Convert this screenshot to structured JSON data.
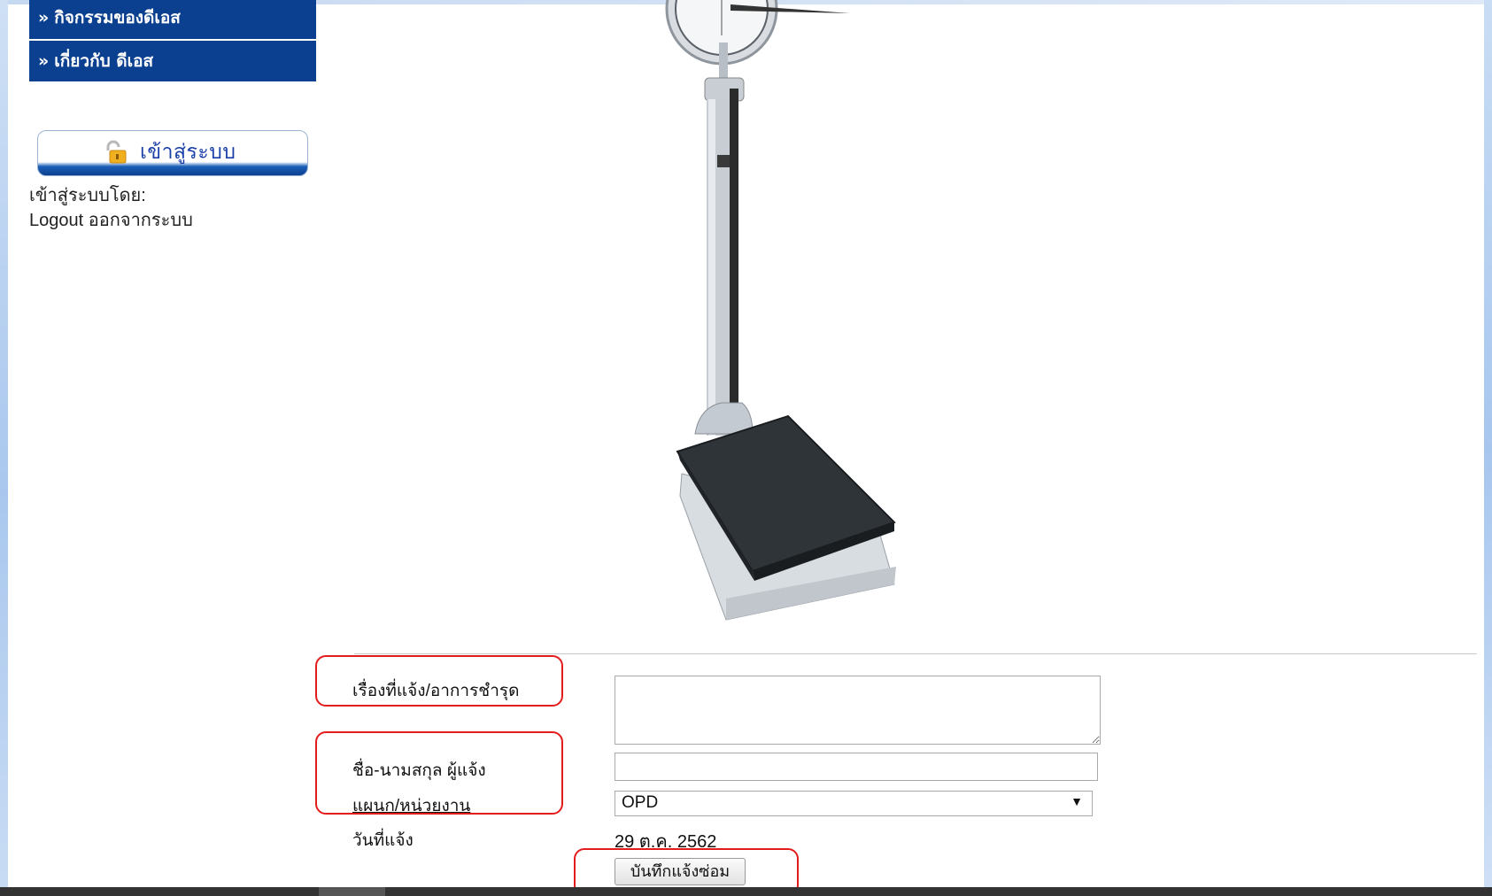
{
  "sidebar": {
    "menu": [
      {
        "label": "กิจกรรมของดีเอส"
      },
      {
        "label": "เกี่ยวกับ ดีเอส"
      }
    ],
    "login_button_label": "เข้าสู่ระบบ",
    "login_by_label": "เข้าสู่ระบบโดย:",
    "logout_label": "Logout ออกจากระบบ"
  },
  "form": {
    "issue_label": "เรื่องที่แจ้ง/อาการชำรุด",
    "issue_value": "",
    "reporter_label": "ชื่อ-นามสกุล ผู้แจ้ง",
    "reporter_value": "",
    "department_label": "แผนก/หน่วยงาน",
    "department_selected": "OPD",
    "date_label": "วันที่แจ้ง",
    "date_value": "29 ต.ค. 2562",
    "submit_label": "บันทึกแจ้งซ่อม"
  },
  "colors": {
    "menu_bg": "#0b3f8f",
    "highlight": "#e31b1b"
  },
  "icons": {
    "menu_arrow": "double-chevron-right-icon",
    "login_button_icon": "padlock-icon",
    "select_caret": "triangle-down-icon"
  }
}
